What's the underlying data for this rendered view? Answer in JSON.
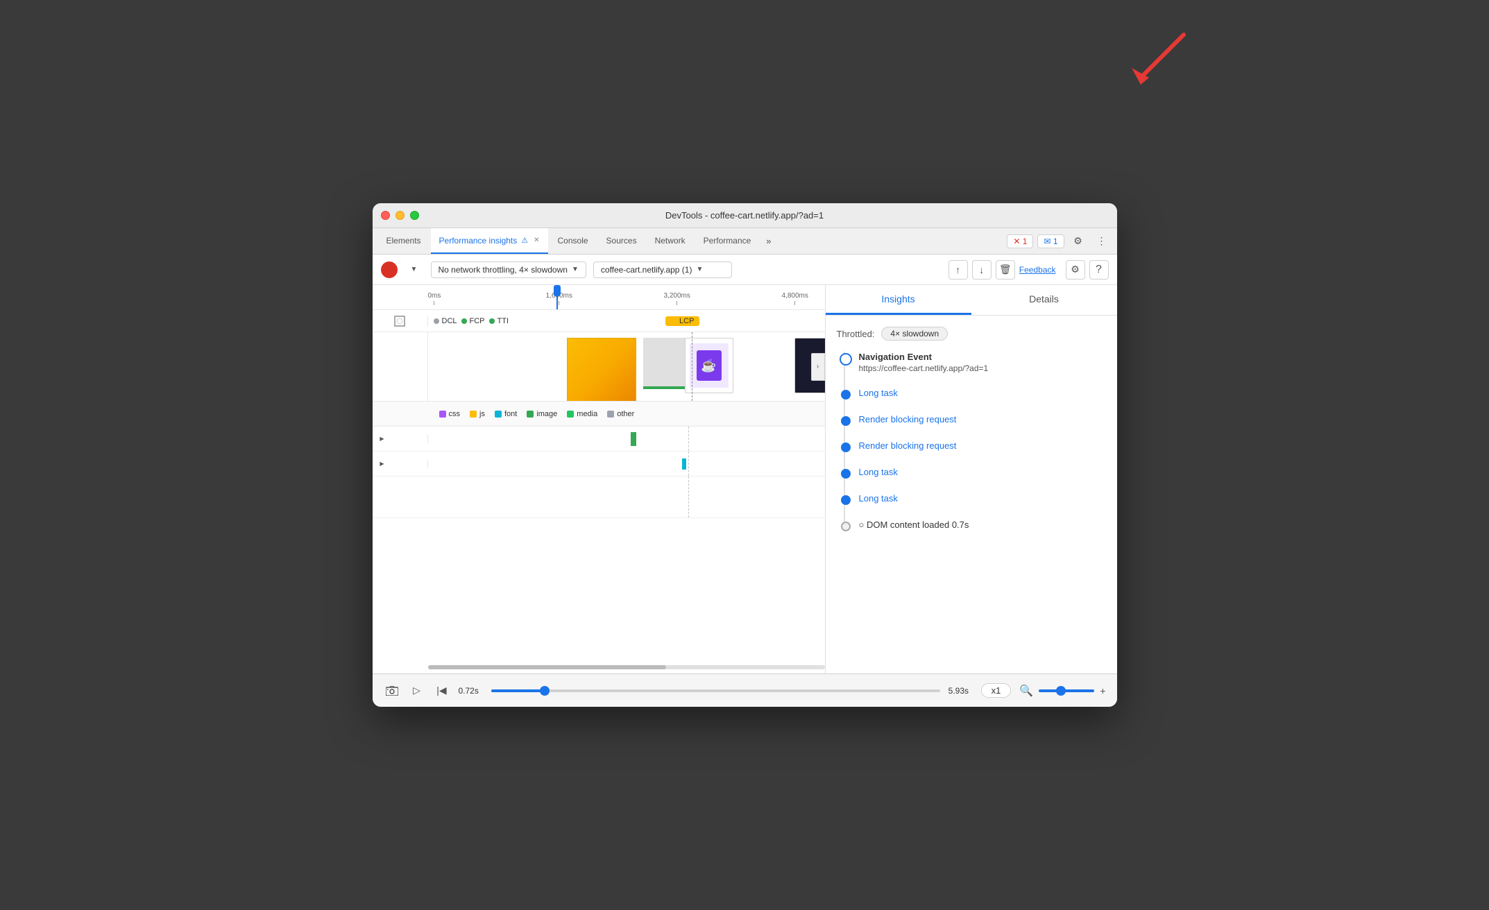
{
  "titlebar": {
    "title": "DevTools - coffee-cart.netlify.app/?ad=1"
  },
  "tabs": {
    "items": [
      {
        "label": "Elements",
        "active": false,
        "id": "elements"
      },
      {
        "label": "Performance insights",
        "active": true,
        "id": "performance-insights"
      },
      {
        "label": "Console",
        "active": false,
        "id": "console"
      },
      {
        "label": "Sources",
        "active": false,
        "id": "sources"
      },
      {
        "label": "Network",
        "active": false,
        "id": "network"
      },
      {
        "label": "Performance",
        "active": false,
        "id": "performance"
      }
    ],
    "more_label": "»",
    "errors_badge": "✕ 1",
    "messages_badge": "✉ 1"
  },
  "toolbar": {
    "throttle_label": "No network throttling, 4× slowdown",
    "url_label": "coffee-cart.netlify.app (1)",
    "feedback_label": "Feedback",
    "record_btn_aria": "Record"
  },
  "timeline": {
    "markers": [
      "0ms",
      "1,600ms",
      "3,200ms",
      "4,800ms"
    ],
    "event_markers": [
      {
        "label": "DCL",
        "color": "blue"
      },
      {
        "label": "FCP",
        "color": "green"
      },
      {
        "label": "TTI",
        "color": "green"
      },
      {
        "label": "LCP",
        "color": "orange"
      }
    ]
  },
  "legend": {
    "items": [
      {
        "label": "css",
        "color": "purple"
      },
      {
        "label": "js",
        "color": "yellow"
      },
      {
        "label": "font",
        "color": "cyan"
      },
      {
        "label": "image",
        "color": "green"
      },
      {
        "label": "media",
        "color": "dark-green"
      },
      {
        "label": "other",
        "color": "grey"
      }
    ]
  },
  "right_panel": {
    "tabs": [
      {
        "label": "Insights",
        "active": true
      },
      {
        "label": "Details",
        "active": false
      }
    ],
    "throttled_label": "Throttled:",
    "throttled_value": "4× slowdown",
    "insights": [
      {
        "type": "navigation",
        "title": "Navigation Event",
        "url": "https://coffee-cart.netlify.app/?ad=1"
      },
      {
        "type": "link",
        "label": "Long task"
      },
      {
        "type": "link",
        "label": "Render blocking request"
      },
      {
        "type": "link",
        "label": "Render blocking request"
      },
      {
        "type": "link",
        "label": "Long task"
      },
      {
        "type": "link",
        "label": "Long task"
      },
      {
        "type": "dom",
        "label": "DOM content loaded 0.7s"
      }
    ]
  },
  "playback": {
    "start_time": "0.72s",
    "end_time": "5.93s",
    "speed": "x1"
  }
}
